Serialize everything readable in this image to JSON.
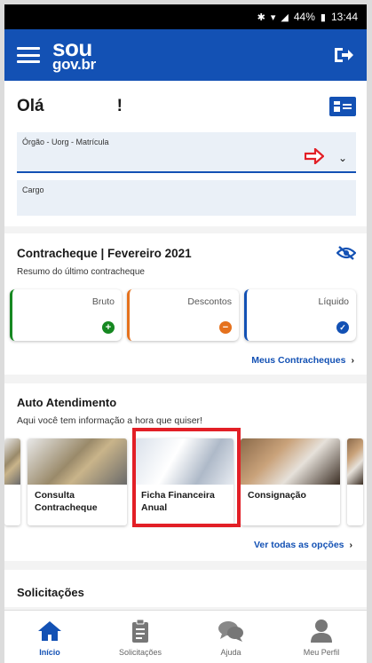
{
  "status_bar": {
    "battery": "44%",
    "time": "13:44"
  },
  "app": {
    "logo_line1": "sou",
    "logo_line2": "gov.br"
  },
  "greeting": {
    "hello": "Olá",
    "exclaim": "!"
  },
  "fields": {
    "orgao_label": "Órgão - Uorg - Matrícula",
    "cargo_label": "Cargo"
  },
  "paycheck": {
    "title": "Contracheque | Fevereiro 2021",
    "subtitle": "Resumo do último contracheque",
    "tiles": [
      {
        "label": "Bruto",
        "icon": "+"
      },
      {
        "label": "Descontos",
        "icon": "−"
      },
      {
        "label": "Líquido",
        "icon": "✓"
      }
    ],
    "link": "Meus Contracheques",
    "chevron": "›"
  },
  "auto": {
    "title": "Auto Atendimento",
    "subtitle": "Aqui você tem informação a hora que quiser!",
    "cards": [
      {
        "line1": "Consulta",
        "line2": "Contracheque"
      },
      {
        "line1": "Ficha Financeira",
        "line2": "Anual"
      },
      {
        "line1": "Consignação",
        "line2": ""
      }
    ],
    "link": "Ver todas as opções",
    "chevron": "›"
  },
  "solicitacoes": {
    "title": "Solicitações"
  },
  "tabs": [
    {
      "label": "Início",
      "icon": "home-icon"
    },
    {
      "label": "Solicitações",
      "icon": "clipboard-icon"
    },
    {
      "label": "Ajuda",
      "icon": "chat-bubbles-icon"
    },
    {
      "label": "Meu Perfil",
      "icon": "user-icon"
    }
  ],
  "colors": {
    "brand": "#1351b4",
    "success": "#168821",
    "warning": "#e5711d",
    "highlight": "#e21f26"
  }
}
